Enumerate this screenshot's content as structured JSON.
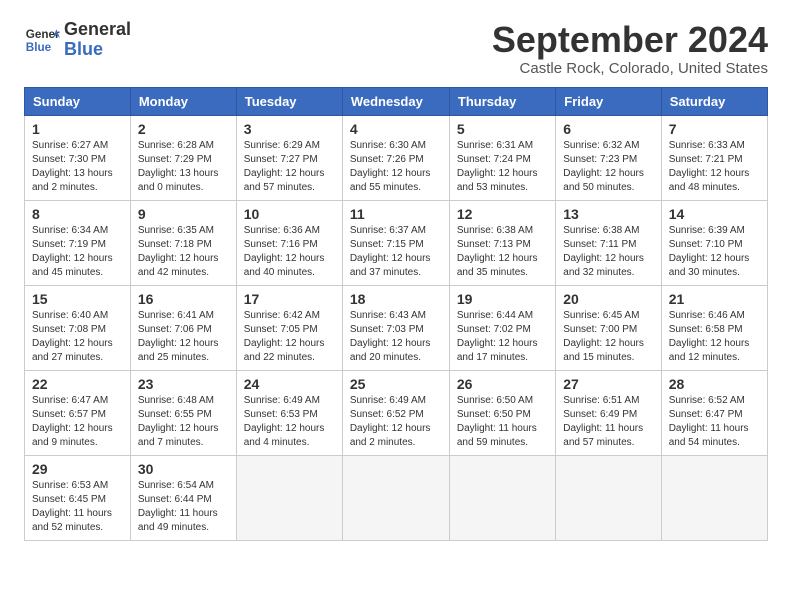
{
  "logo": {
    "line1": "General",
    "line2": "Blue"
  },
  "title": "September 2024",
  "location": "Castle Rock, Colorado, United States",
  "days_of_week": [
    "Sunday",
    "Monday",
    "Tuesday",
    "Wednesday",
    "Thursday",
    "Friday",
    "Saturday"
  ],
  "weeks": [
    [
      {
        "day": 1,
        "sunrise": "6:27 AM",
        "sunset": "7:30 PM",
        "daylight": "13 hours and 2 minutes."
      },
      {
        "day": 2,
        "sunrise": "6:28 AM",
        "sunset": "7:29 PM",
        "daylight": "13 hours and 0 minutes."
      },
      {
        "day": 3,
        "sunrise": "6:29 AM",
        "sunset": "7:27 PM",
        "daylight": "12 hours and 57 minutes."
      },
      {
        "day": 4,
        "sunrise": "6:30 AM",
        "sunset": "7:26 PM",
        "daylight": "12 hours and 55 minutes."
      },
      {
        "day": 5,
        "sunrise": "6:31 AM",
        "sunset": "7:24 PM",
        "daylight": "12 hours and 53 minutes."
      },
      {
        "day": 6,
        "sunrise": "6:32 AM",
        "sunset": "7:23 PM",
        "daylight": "12 hours and 50 minutes."
      },
      {
        "day": 7,
        "sunrise": "6:33 AM",
        "sunset": "7:21 PM",
        "daylight": "12 hours and 48 minutes."
      }
    ],
    [
      {
        "day": 8,
        "sunrise": "6:34 AM",
        "sunset": "7:19 PM",
        "daylight": "12 hours and 45 minutes."
      },
      {
        "day": 9,
        "sunrise": "6:35 AM",
        "sunset": "7:18 PM",
        "daylight": "12 hours and 42 minutes."
      },
      {
        "day": 10,
        "sunrise": "6:36 AM",
        "sunset": "7:16 PM",
        "daylight": "12 hours and 40 minutes."
      },
      {
        "day": 11,
        "sunrise": "6:37 AM",
        "sunset": "7:15 PM",
        "daylight": "12 hours and 37 minutes."
      },
      {
        "day": 12,
        "sunrise": "6:38 AM",
        "sunset": "7:13 PM",
        "daylight": "12 hours and 35 minutes."
      },
      {
        "day": 13,
        "sunrise": "6:38 AM",
        "sunset": "7:11 PM",
        "daylight": "12 hours and 32 minutes."
      },
      {
        "day": 14,
        "sunrise": "6:39 AM",
        "sunset": "7:10 PM",
        "daylight": "12 hours and 30 minutes."
      }
    ],
    [
      {
        "day": 15,
        "sunrise": "6:40 AM",
        "sunset": "7:08 PM",
        "daylight": "12 hours and 27 minutes."
      },
      {
        "day": 16,
        "sunrise": "6:41 AM",
        "sunset": "7:06 PM",
        "daylight": "12 hours and 25 minutes."
      },
      {
        "day": 17,
        "sunrise": "6:42 AM",
        "sunset": "7:05 PM",
        "daylight": "12 hours and 22 minutes."
      },
      {
        "day": 18,
        "sunrise": "6:43 AM",
        "sunset": "7:03 PM",
        "daylight": "12 hours and 20 minutes."
      },
      {
        "day": 19,
        "sunrise": "6:44 AM",
        "sunset": "7:02 PM",
        "daylight": "12 hours and 17 minutes."
      },
      {
        "day": 20,
        "sunrise": "6:45 AM",
        "sunset": "7:00 PM",
        "daylight": "12 hours and 15 minutes."
      },
      {
        "day": 21,
        "sunrise": "6:46 AM",
        "sunset": "6:58 PM",
        "daylight": "12 hours and 12 minutes."
      }
    ],
    [
      {
        "day": 22,
        "sunrise": "6:47 AM",
        "sunset": "6:57 PM",
        "daylight": "12 hours and 9 minutes."
      },
      {
        "day": 23,
        "sunrise": "6:48 AM",
        "sunset": "6:55 PM",
        "daylight": "12 hours and 7 minutes."
      },
      {
        "day": 24,
        "sunrise": "6:49 AM",
        "sunset": "6:53 PM",
        "daylight": "12 hours and 4 minutes."
      },
      {
        "day": 25,
        "sunrise": "6:49 AM",
        "sunset": "6:52 PM",
        "daylight": "12 hours and 2 minutes."
      },
      {
        "day": 26,
        "sunrise": "6:50 AM",
        "sunset": "6:50 PM",
        "daylight": "11 hours and 59 minutes."
      },
      {
        "day": 27,
        "sunrise": "6:51 AM",
        "sunset": "6:49 PM",
        "daylight": "11 hours and 57 minutes."
      },
      {
        "day": 28,
        "sunrise": "6:52 AM",
        "sunset": "6:47 PM",
        "daylight": "11 hours and 54 minutes."
      }
    ],
    [
      {
        "day": 29,
        "sunrise": "6:53 AM",
        "sunset": "6:45 PM",
        "daylight": "11 hours and 52 minutes."
      },
      {
        "day": 30,
        "sunrise": "6:54 AM",
        "sunset": "6:44 PM",
        "daylight": "11 hours and 49 minutes."
      },
      null,
      null,
      null,
      null,
      null
    ]
  ]
}
